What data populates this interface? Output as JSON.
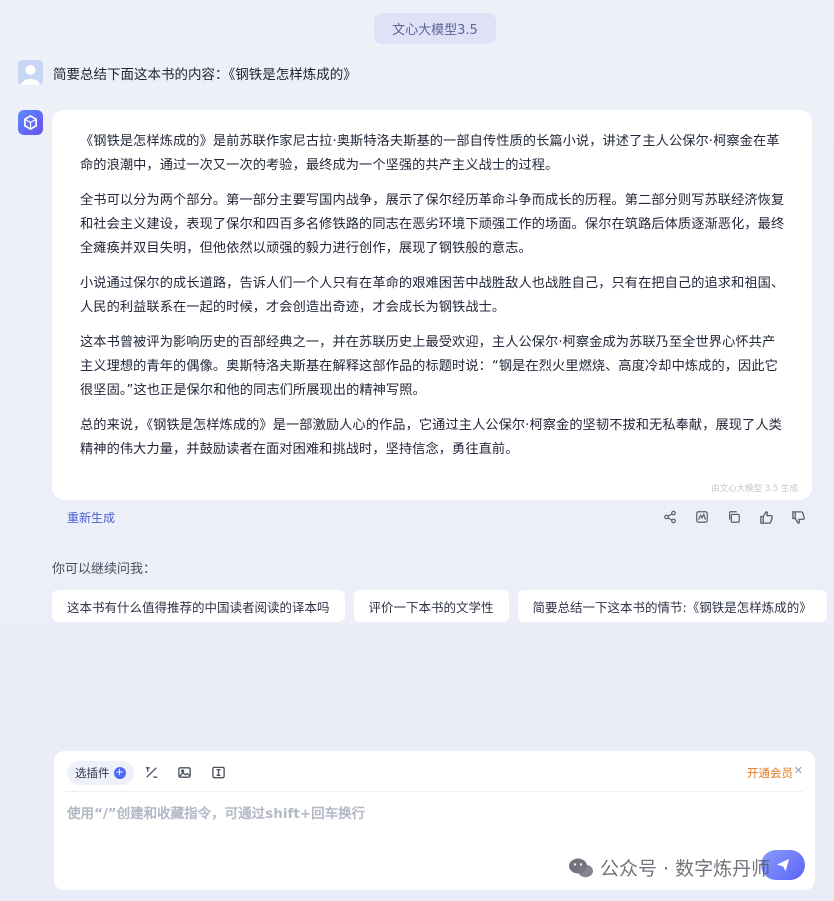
{
  "header": {
    "model_label": "文心大模型3.5"
  },
  "user": {
    "question": "简要总结下面这本书的内容：《钢铁是怎样炼成的》"
  },
  "answer": {
    "paragraphs": [
      "《钢铁是怎样炼成的》是前苏联作家尼古拉·奥斯特洛夫斯基的一部自传性质的长篇小说，讲述了主人公保尔·柯察金在革命的浪潮中，通过一次又一次的考验，最终成为一个坚强的共产主义战士的过程。",
      "全书可以分为两个部分。第一部分主要写国内战争，展示了保尔经历革命斗争而成长的历程。第二部分则写苏联经济恢复和社会主义建设，表现了保尔和四百多名修铁路的同志在恶劣环境下顽强工作的场面。保尔在筑路后体质逐渐恶化，最终全瘫痪并双目失明，但他依然以顽强的毅力进行创作，展现了钢铁般的意志。",
      "小说通过保尔的成长道路，告诉人们一个人只有在革命的艰难困苦中战胜敌人也战胜自己，只有在把自己的追求和祖国、人民的利益联系在一起的时候，才会创造出奇迹，才会成长为钢铁战士。",
      "这本书曾被评为影响历史的百部经典之一，并在苏联历史上最受欢迎，主人公保尔·柯察金成为苏联乃至全世界心怀共产主义理想的青年的偶像。奥斯特洛夫斯基在解释这部作品的标题时说：“钢是在烈火里燃烧、高度冷却中炼成的，因此它很坚固。”这也正是保尔和他的同志们所展现出的精神写照。",
      "总的来说，《钢铁是怎样炼成的》是一部激励人心的作品，它通过主人公保尔·柯察金的坚韧不拔和无私奉献，展现了人类精神的伟大力量，并鼓励读者在面对困难和挑战时，坚持信念，勇往直前。"
    ],
    "generated_by": "由文心大模型 3.5 生成",
    "regenerate_label": "重新生成"
  },
  "suggestions": {
    "title": "你可以继续问我：",
    "items": [
      "这本书有什么值得推荐的中国读者阅读的译本吗",
      "评价一下本书的文学性",
      "简要总结一下这本书的情节:《钢铁是怎样炼成的》"
    ]
  },
  "input": {
    "plugin_label": "选插件",
    "vip_label": "开通会员",
    "placeholder": "使用“/”创建和收藏指令，可通过shift+回车换行"
  },
  "watermark": {
    "text": "公众号 · 数字炼丹师"
  },
  "colors": {
    "accent": "#4f6bf0",
    "vip": "#e07a1f",
    "background": "#eef0f8"
  }
}
